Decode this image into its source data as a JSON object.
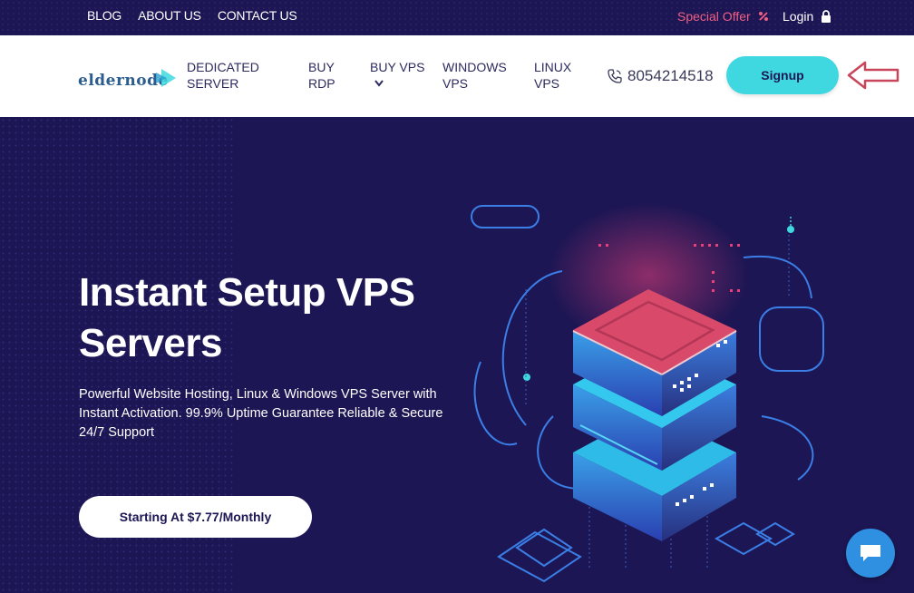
{
  "topbar": {
    "links": [
      "BLOG",
      "ABOUT US",
      "CONTACT US"
    ],
    "special_offer": "Special Offer",
    "login": "Login"
  },
  "nav": {
    "logo_text": "eldernode",
    "items": [
      {
        "line1": "DEDICATED",
        "line2": "SERVER"
      },
      {
        "line1": "BUY",
        "line2": "RDP"
      },
      {
        "line1": "BUY VPS",
        "line2": ""
      },
      {
        "line1": "WINDOWS",
        "line2": "VPS"
      },
      {
        "line1": "LINUX",
        "line2": "VPS"
      }
    ],
    "phone": "8054214518",
    "signup": "Signup"
  },
  "hero": {
    "title": "Instant Setup VPS Servers",
    "description": "Powerful Website Hosting, Linux & Windows VPS Server with Instant Activation. 99.9% Uptime Guarantee Reliable & Secure 24/7 Support",
    "cta": "Starting At $7.77/Monthly"
  },
  "colors": {
    "dark": "#1d1654",
    "accent": "#3fd8e0",
    "offer": "#f05f83",
    "chat": "#2f8fe0"
  },
  "icons": [
    "percent-icon",
    "lock-icon",
    "phone-icon",
    "chevron-down-icon",
    "arrow-left-icon",
    "chat-icon"
  ]
}
